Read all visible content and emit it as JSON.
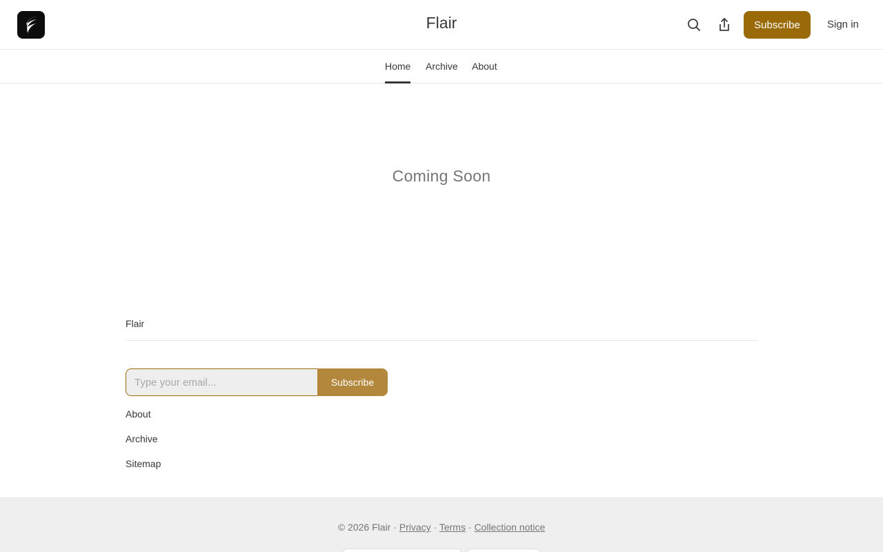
{
  "header": {
    "logo_icon": "feather-logo-icon",
    "title": "Flair",
    "search_icon": "search-icon",
    "share_icon": "share-icon",
    "subscribe_label": "Subscribe",
    "signin_label": "Sign in",
    "accent_color": "#9a6a08"
  },
  "nav": {
    "tabs": [
      {
        "label": "Home",
        "active": true
      },
      {
        "label": "Archive",
        "active": false
      },
      {
        "label": "About",
        "active": false
      }
    ]
  },
  "main": {
    "message": "Coming Soon"
  },
  "footer": {
    "publication_name": "Flair",
    "email_placeholder": "Type your email...",
    "subscribe_label": "Subscribe",
    "links": [
      "About",
      "Archive",
      "Sitemap"
    ]
  },
  "bottom": {
    "copyright": "© 2026 Flair",
    "separator": "·",
    "privacy_label": "Privacy",
    "terms_label": "Terms",
    "collection_label": "Collection notice"
  }
}
